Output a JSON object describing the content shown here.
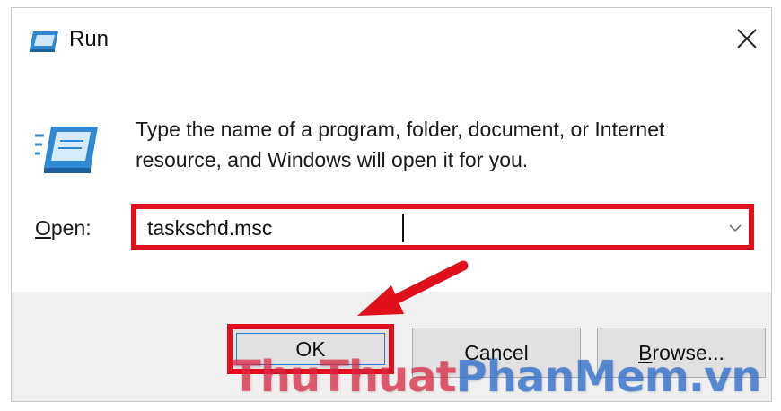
{
  "window": {
    "title": "Run",
    "close_glyph": "✕"
  },
  "description": "Type the name of a program, folder, document, or Internet resource, and Windows will open it for you.",
  "open_field": {
    "label_underlined": "O",
    "label_rest": "pen:",
    "value": "taskschd.msc"
  },
  "buttons": {
    "ok": "OK",
    "cancel": "Cancel",
    "browse_underlined": "B",
    "browse_rest": "rowse..."
  },
  "watermark": {
    "part1": "ThuThuat",
    "part2": "PhanMem.vn"
  },
  "icons": {
    "title_icon": "run-icon",
    "body_icon": "run-icon",
    "close_icon": "close-icon",
    "dropdown_icon": "chevron-down-icon",
    "annotation_arrow": "arrow-icon"
  },
  "colors": {
    "highlight": "#e0101c",
    "focus": "#2b78d2",
    "footer_bg": "#f0f0f0"
  }
}
